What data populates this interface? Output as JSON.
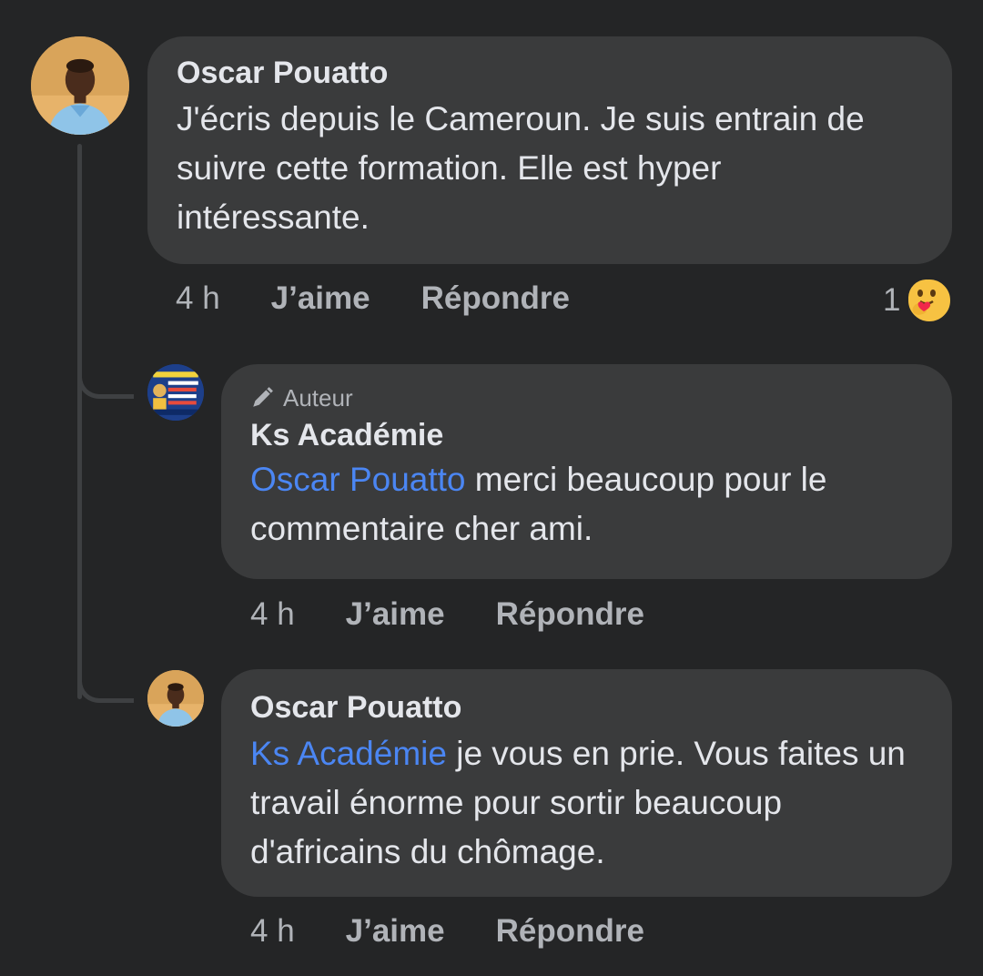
{
  "comments": [
    {
      "author": "Oscar Pouatto",
      "text": "J'écris depuis le Cameroun. Je suis entrain de suivre cette formation. Elle est hyper intéressante.",
      "time": "4 h",
      "like_label": "J’aime",
      "reply_label": "Répondre",
      "reaction_count": "1",
      "reaction_icon": "care-emoji-icon"
    }
  ],
  "replies": [
    {
      "badge": "Auteur",
      "author": "Ks Académie",
      "mention": "Oscar Pouatto",
      "text": " merci beaucoup pour le commentaire cher ami.",
      "time": "4 h",
      "like_label": "J’aime",
      "reply_label": "Répondre"
    },
    {
      "author": "Oscar Pouatto",
      "mention": "Ks Académie",
      "text": " je vous en prie. Vous faites un travail énorme pour sortir beaucoup d'africains du chômage.",
      "time": "4 h",
      "like_label": "J’aime",
      "reply_label": "Répondre"
    }
  ],
  "colors": {
    "background": "#242526",
    "bubble": "#3a3b3c",
    "mention": "#4b86f3",
    "secondary_text": "#b0b3b8"
  }
}
